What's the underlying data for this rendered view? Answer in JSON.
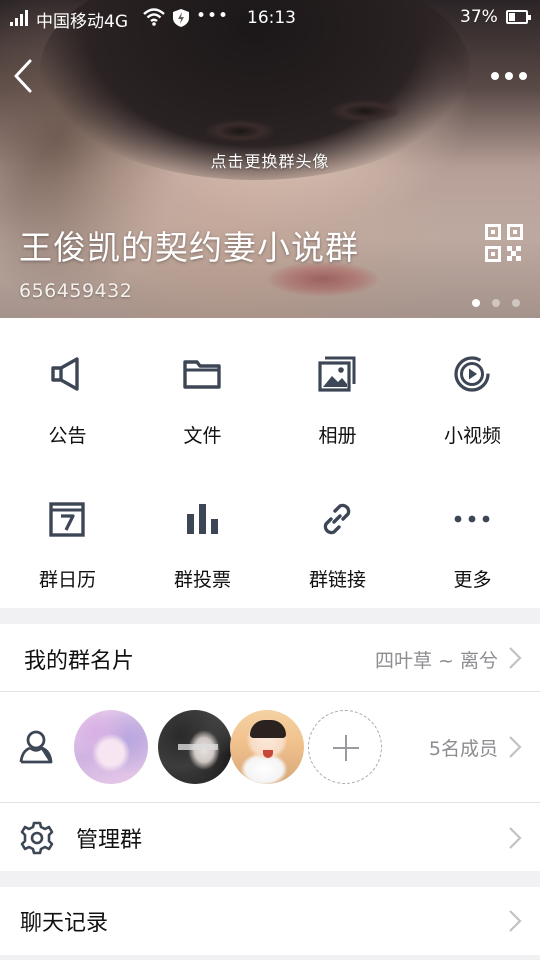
{
  "status_bar": {
    "carrier": "中国移动4G",
    "more_symbol": "•••",
    "time": "16:13",
    "battery": "37%"
  },
  "header": {
    "change_avatar_hint": "点击更换群头像",
    "group_name": "王俊凯的契约妻小说群",
    "group_id": "656459432",
    "page_count": 3,
    "current_page": 1
  },
  "functions": [
    {
      "label": "公告",
      "icon": "megaphone-icon"
    },
    {
      "label": "文件",
      "icon": "folder-icon"
    },
    {
      "label": "相册",
      "icon": "photo-album-icon"
    },
    {
      "label": "小视频",
      "icon": "video-play-icon"
    },
    {
      "label": "群日历",
      "icon": "calendar-icon"
    },
    {
      "label": "群投票",
      "icon": "bar-chart-icon"
    },
    {
      "label": "群链接",
      "icon": "link-icon"
    },
    {
      "label": "更多",
      "icon": "more-dots-icon"
    }
  ],
  "my_card": {
    "title": "我的群名片",
    "value": "四叶草 ~ 离兮"
  },
  "members": {
    "count_label": "5名成员"
  },
  "manage": {
    "title": "管理群"
  },
  "chat_history": {
    "title": "聊天记录"
  },
  "colors": {
    "icon_color": "#3d4654",
    "secondary_text": "#8d8d92",
    "background": "#f1f1f4"
  }
}
